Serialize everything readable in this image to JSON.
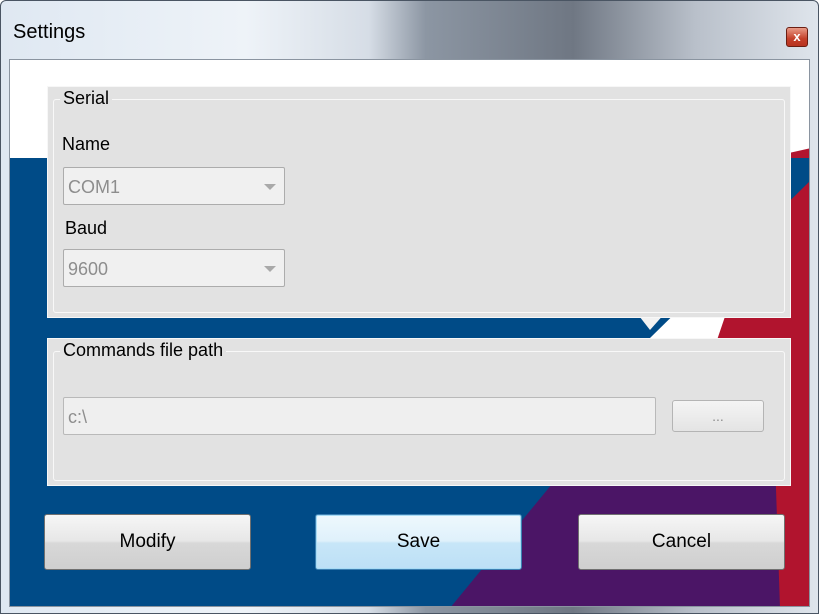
{
  "window": {
    "title": "Settings",
    "close_glyph": "x"
  },
  "serial_group": {
    "legend": "Serial",
    "name_label": "Name",
    "name_value": "COM1",
    "baud_label": "Baud",
    "baud_value": "9600"
  },
  "commands_group": {
    "legend": "Commands file path",
    "path_value": "c:\\",
    "browse_label": "..."
  },
  "buttons": {
    "modify": "Modify",
    "save": "Save",
    "cancel": "Cancel"
  },
  "colors": {
    "background_blue": "#004b87",
    "background_red": "#b1142e",
    "background_purple": "#4b1566",
    "focus_border": "#3c7fb1"
  },
  "icons": {
    "close": "close-icon",
    "dropdown": "chevron-down-icon"
  }
}
